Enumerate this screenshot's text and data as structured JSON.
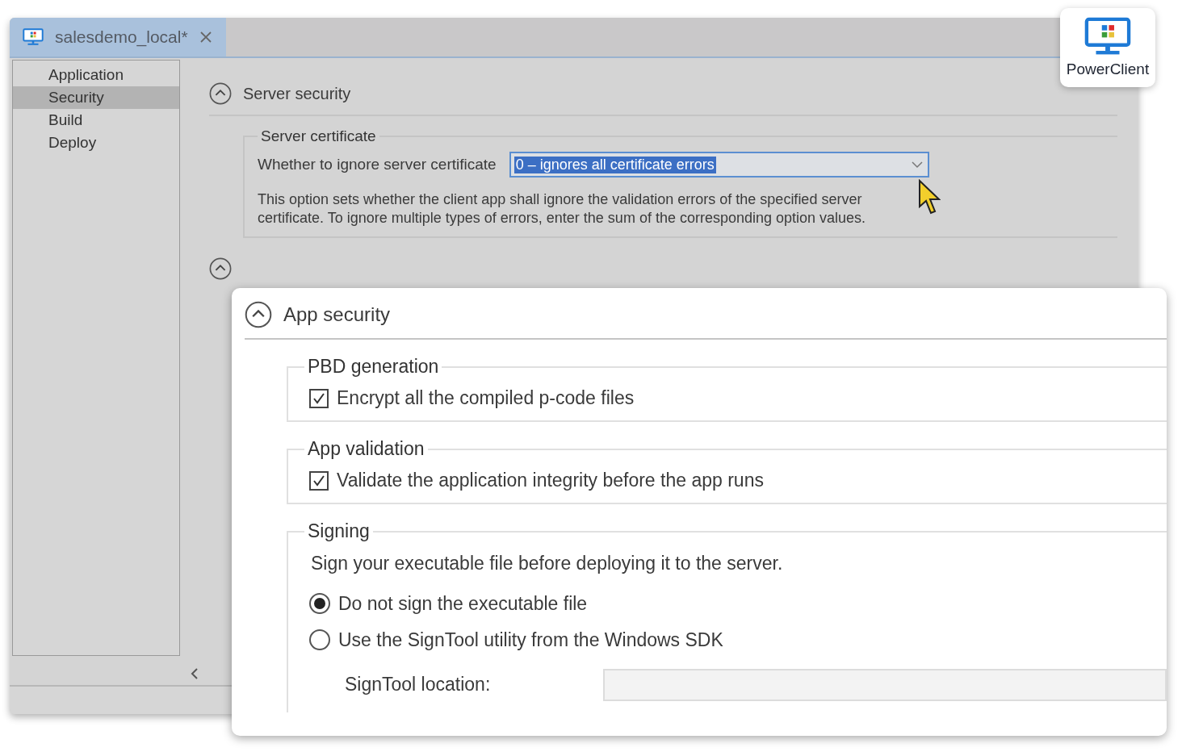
{
  "tab": {
    "title": "salesdemo_local*"
  },
  "sidebar": {
    "items": [
      {
        "label": "Application",
        "selected": false
      },
      {
        "label": "Security",
        "selected": true
      },
      {
        "label": "Build",
        "selected": false
      },
      {
        "label": "Deploy",
        "selected": false
      }
    ]
  },
  "server_security": {
    "title": "Server security",
    "expanded": true,
    "group": {
      "title": "Server certificate",
      "field_label": "Whether to ignore server certificate",
      "value": "0 – ignores all certificate errors",
      "description": "This option sets whether the client app shall ignore the validation errors of the specified server certificate. To ignore multiple types of errors, enter the sum of the corresponding option values."
    }
  },
  "app_security": {
    "title": "App security",
    "expanded": true,
    "groups": [
      {
        "kind": "checkbox",
        "title": "PBD generation",
        "label": "Encrypt all the compiled p-code files",
        "checked": true
      },
      {
        "kind": "checkbox",
        "title": "App validation",
        "label": "Validate the application integrity before the app runs",
        "checked": true
      },
      {
        "kind": "radio",
        "title": "Signing",
        "description": "Sign your executable file before deploying it to the server.",
        "options": [
          {
            "label": "Do not sign the executable file",
            "selected": true
          },
          {
            "label": "Use the SignTool utility from the Windows SDK",
            "selected": false
          }
        ],
        "field_label": "SignTool location:"
      }
    ]
  },
  "badge": {
    "label": "PowerClient"
  }
}
